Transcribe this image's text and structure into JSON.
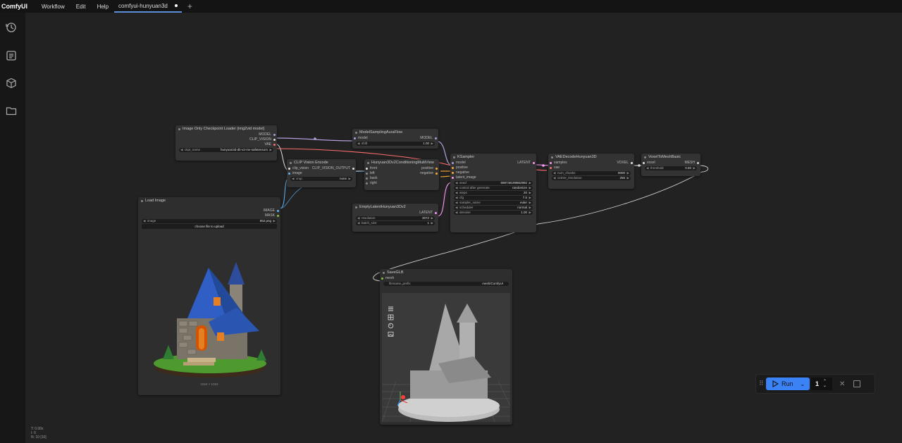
{
  "app": {
    "name": "ComfyUI"
  },
  "menu": [
    "Workflow",
    "Edit",
    "Help"
  ],
  "tab": {
    "label": "comfyui-hunyuan3d"
  },
  "nodes": {
    "checkpoint": {
      "title": "Image Only Checkpoint Loader (img2vid model)",
      "out_model": "MODEL",
      "out_clip_vision": "CLIP_VISION",
      "out_vae": "VAE",
      "ckpt_label": "ckpt_name",
      "ckpt_value": "hunyuan3d-dit-v2-mv-safetensors"
    },
    "sampling": {
      "title": "ModelSamplingAuraFlow",
      "in_model": "model",
      "out_model": "MODEL",
      "shift_label": "shift",
      "shift_value": "1.00"
    },
    "clipvision": {
      "title": "CLIP Vision Encode",
      "in1": "clip_vision",
      "in2": "image",
      "out": "CLIP_VISION_OUTPUT",
      "crop_label": "crop",
      "crop_value": "none"
    },
    "conditioning": {
      "title": "Hunyuan3Dv2ConditioningMultiView",
      "in1": "front",
      "in2": "left",
      "in3": "back",
      "in4": "right",
      "out1": "positive",
      "out2": "negative"
    },
    "ksampler": {
      "title": "KSampler",
      "in1": "model",
      "in2": "positive",
      "in3": "negative",
      "in4": "latent_image",
      "out": "LATENT",
      "widgets": [
        {
          "label": "seed",
          "value": "698748199862992"
        },
        {
          "label": "control after generate",
          "value": "randomize"
        },
        {
          "label": "steps",
          "value": "20"
        },
        {
          "label": "cfg",
          "value": "7.5"
        },
        {
          "label": "sampler_name",
          "value": "euler"
        },
        {
          "label": "scheduler",
          "value": "normal"
        },
        {
          "label": "denoise",
          "value": "1.00"
        }
      ]
    },
    "vaedecode": {
      "title": "VAEDecodeHunyuan3D",
      "in1": "samples",
      "in2": "vae",
      "out": "VOXEL",
      "w1_label": "num_chunks",
      "w1_value": "8000",
      "w2_label": "octree_resolution",
      "w2_value": "256"
    },
    "voxel": {
      "title": "VoxelToMeshBasic",
      "in1": "voxel",
      "out": "MESH",
      "w_label": "threshold",
      "w_value": "0.60"
    },
    "latent": {
      "title": "EmptyLatentHunyuan3Dv2",
      "out": "LATENT",
      "w1_label": "resolution",
      "w1_value": "3072",
      "w2_label": "batch_size",
      "w2_value": "1"
    },
    "loadimage": {
      "title": "Load Image",
      "out1": "IMAGE",
      "out2": "MASK",
      "w_label": "image",
      "w_value": "852.png",
      "button": "choose file to upload",
      "caption": "1024 × 1024"
    },
    "saveglb": {
      "title": "SaveGLB",
      "in1": "mesh",
      "w_label": "filename_prefix",
      "w_value": "mesh/ComfyUI"
    }
  },
  "run": {
    "label": "Run",
    "count": "1"
  },
  "status": {
    "line1": "T: 0.00s",
    "line2": "I: 0",
    "line3": "N: 10 [10]"
  },
  "colors": {
    "accent": "#3b82f6",
    "model_wire": "#b39ddb",
    "clip_wire": "#e0e0e0",
    "vae_wire": "#ff6e6e",
    "cond_wire": "#ffa931",
    "latent_wire": "#ff9cf9",
    "image_wire": "#64b5f6"
  }
}
